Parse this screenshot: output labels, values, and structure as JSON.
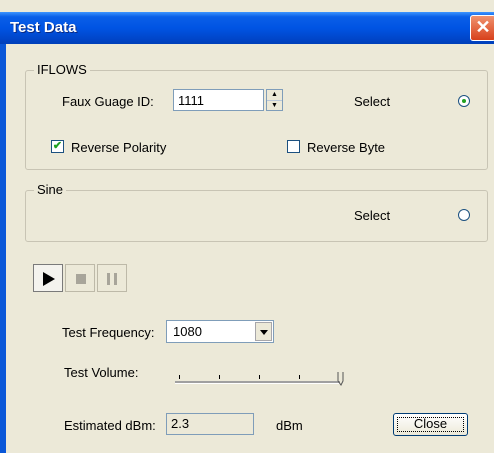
{
  "dialog": {
    "title": "Test Data",
    "close_glyph": "✕"
  },
  "iflows": {
    "legend": "IFLOWS",
    "gauge_label": "Faux Guage ID:",
    "gauge_value": "1111",
    "select_label": "Select",
    "select_checked": true,
    "reverse_polarity_label": "Reverse Polarity",
    "reverse_polarity_checked": true,
    "reverse_byte_label": "Reverse Byte",
    "reverse_byte_checked": false
  },
  "sine": {
    "legend": "Sine",
    "select_label": "Select",
    "select_checked": false
  },
  "transport": {
    "play_icon": "play-icon",
    "stop_icon": "stop-icon",
    "pause_icon": "pause-icon"
  },
  "settings": {
    "frequency_label": "Test Frequency:",
    "frequency_value": "1080",
    "volume_label": "Test Volume:",
    "volume_level": 1.0,
    "dbm_label": "Estimated dBm:",
    "dbm_value": "2.3",
    "dbm_unit": "dBm"
  },
  "footer": {
    "close_label": "Close"
  },
  "colors": {
    "titlebar": "#0054e3",
    "face": "#ece9d8",
    "check_accent": "#21a121"
  }
}
